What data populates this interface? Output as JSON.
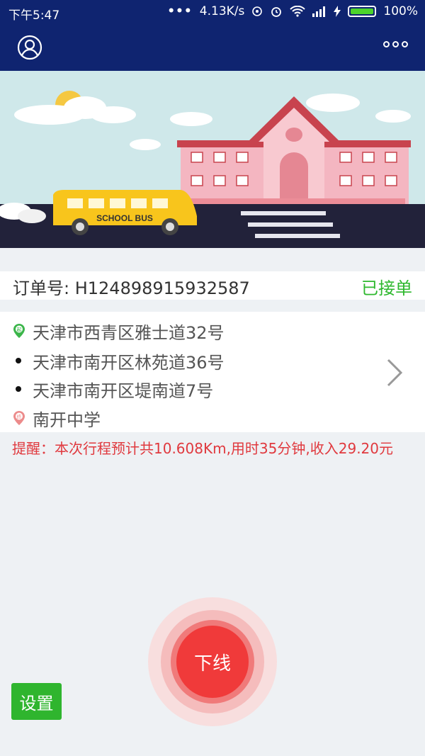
{
  "status_bar": {
    "time": "下午5:47",
    "network_speed": "4.13K/s",
    "battery": "100%"
  },
  "order": {
    "number_label": "订单号: H124898915932587",
    "status": "已接单"
  },
  "route": {
    "start_badge": "起",
    "end_badge": "终",
    "stops": [
      "天津市西青区雅士道32号",
      "天津市南开区林苑道36号",
      "天津市南开区堤南道7号",
      "南开中学"
    ]
  },
  "banner": {
    "bus_text": "SCHOOL BUS"
  },
  "tip": "提醒：本次行程预计共10.608Km,用时35分钟,收入29.20元",
  "buttons": {
    "offline": "下线",
    "settings": "设置"
  },
  "colors": {
    "header_bg": "#0f2470",
    "status_green": "#2eb82e",
    "tip_red": "#e0393e",
    "offline_red": "#f03a3a"
  }
}
